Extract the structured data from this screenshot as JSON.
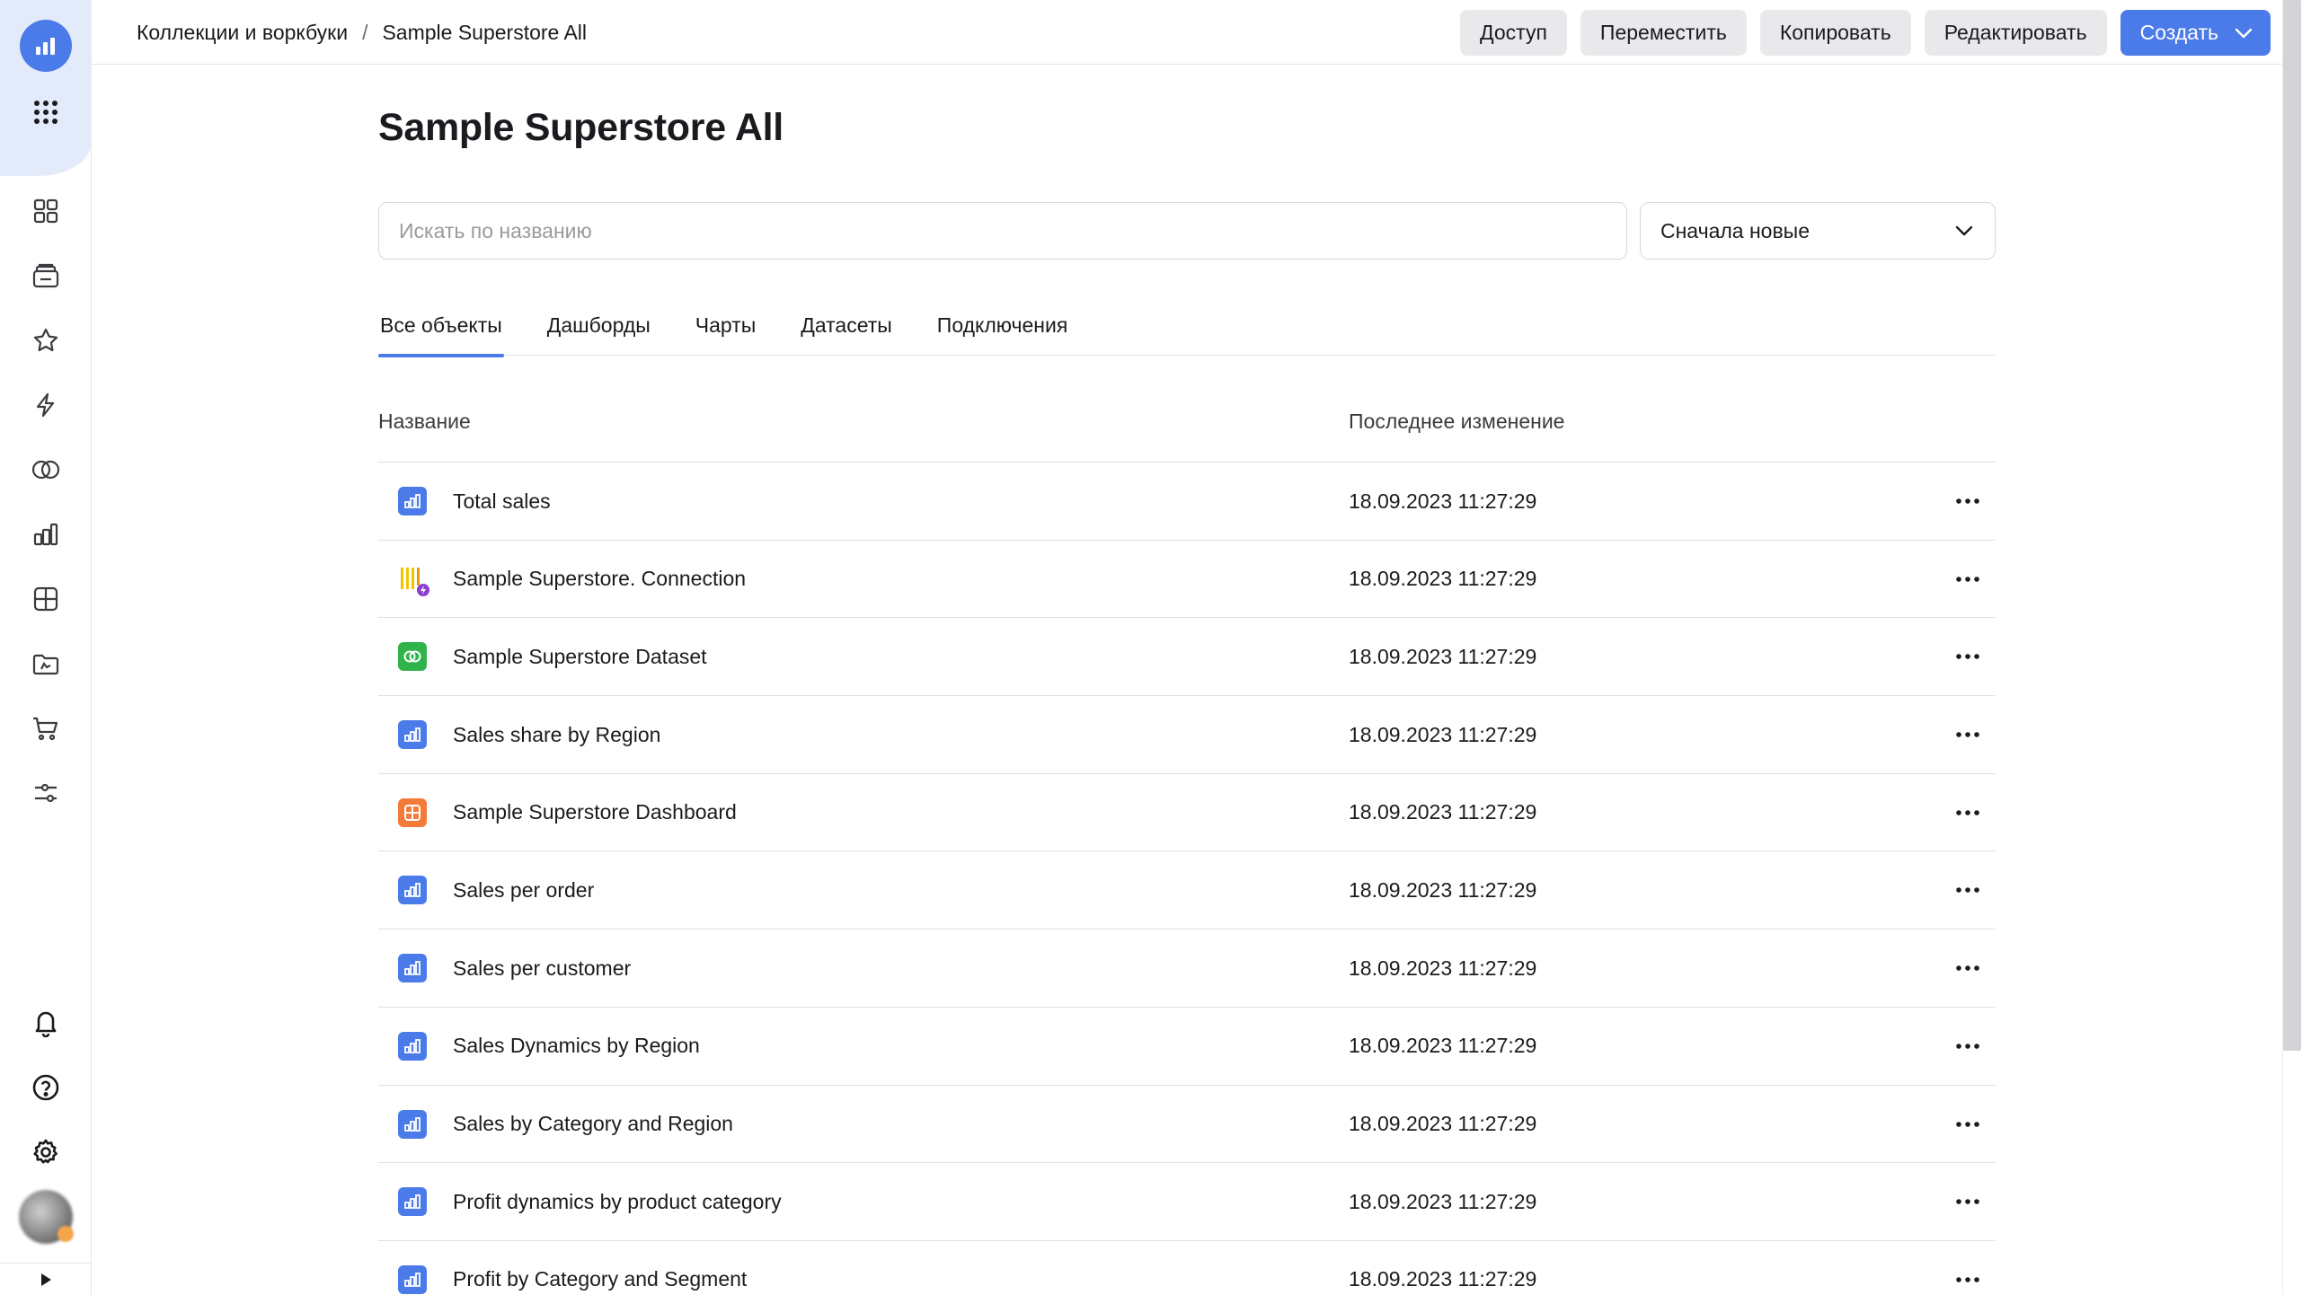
{
  "header": {
    "breadcrumb": {
      "root": "Коллекции и воркбуки",
      "current": "Sample Superstore All"
    },
    "actions": {
      "access": "Доступ",
      "move": "Переместить",
      "copy": "Копировать",
      "edit": "Редактировать",
      "create": "Создать"
    }
  },
  "page": {
    "title": "Sample Superstore All",
    "search_placeholder": "Искать по названию",
    "sort_selected": "Сначала новые"
  },
  "tabs": [
    "Все объекты",
    "Дашборды",
    "Чарты",
    "Датасеты",
    "Подключения"
  ],
  "active_tab": "Все объекты",
  "table": {
    "columns": {
      "name": "Название",
      "modified": "Последнее изменение"
    },
    "rows": [
      {
        "type": "chart",
        "name": "Total sales",
        "modified": "18.09.2023 11:27:29"
      },
      {
        "type": "connection",
        "name": "Sample Superstore. Connection",
        "modified": "18.09.2023 11:27:29"
      },
      {
        "type": "dataset",
        "name": "Sample Superstore Dataset",
        "modified": "18.09.2023 11:27:29"
      },
      {
        "type": "chart",
        "name": "Sales share by Region",
        "modified": "18.09.2023 11:27:29"
      },
      {
        "type": "dashboard",
        "name": "Sample Superstore Dashboard",
        "modified": "18.09.2023 11:27:29"
      },
      {
        "type": "chart",
        "name": "Sales per order",
        "modified": "18.09.2023 11:27:29"
      },
      {
        "type": "chart",
        "name": "Sales per customer",
        "modified": "18.09.2023 11:27:29"
      },
      {
        "type": "chart",
        "name": "Sales Dynamics by Region",
        "modified": "18.09.2023 11:27:29"
      },
      {
        "type": "chart",
        "name": "Sales by Category and Region",
        "modified": "18.09.2023 11:27:29"
      },
      {
        "type": "chart",
        "name": "Profit dynamics by product category",
        "modified": "18.09.2023 11:27:29"
      },
      {
        "type": "chart",
        "name": "Profit by Category and Segment",
        "modified": "18.09.2023 11:27:29"
      }
    ]
  },
  "sidebar": {
    "icons": [
      "grid-icon",
      "collections-icon",
      "star-icon",
      "lightning-icon",
      "dataset-rings-icon",
      "chart-icon",
      "dashboard-icon",
      "folder-icon",
      "cart-icon",
      "sliders-icon"
    ],
    "bottom_icons": [
      "bell-icon",
      "help-icon",
      "gear-icon"
    ]
  },
  "colors": {
    "accent": "#4b7be8",
    "dataset": "#2fb34a",
    "dashboard": "#f47a3a",
    "connection": "#f2c200"
  }
}
